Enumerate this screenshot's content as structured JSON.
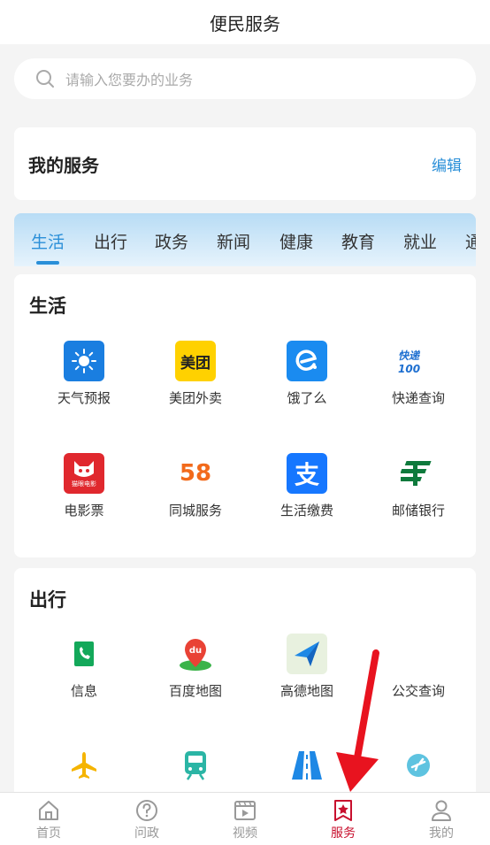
{
  "header": {
    "title": "便民服务"
  },
  "search": {
    "placeholder": "请输入您要办的业务"
  },
  "my_services": {
    "title": "我的服务",
    "edit_label": "编辑"
  },
  "category_tabs": [
    {
      "label": "生活",
      "active": true
    },
    {
      "label": "出行"
    },
    {
      "label": "政务"
    },
    {
      "label": "新闻"
    },
    {
      "label": "健康"
    },
    {
      "label": "教育"
    },
    {
      "label": "就业"
    },
    {
      "label": "通"
    }
  ],
  "sections": {
    "life": {
      "title": "生活",
      "items": [
        {
          "label": "天气预报",
          "icon": "weather-icon"
        },
        {
          "label": "美团外卖",
          "icon": "meituan-icon",
          "icon_text": "美团"
        },
        {
          "label": "饿了么",
          "icon": "eleme-icon"
        },
        {
          "label": "快递查询",
          "icon": "express-icon",
          "icon_text": "快递100"
        },
        {
          "label": "电影票",
          "icon": "maoyan-movie-icon",
          "icon_text": "猫眼电影"
        },
        {
          "label": "同城服务",
          "icon": "58-icon",
          "icon_text": "58"
        },
        {
          "label": "生活缴费",
          "icon": "alipay-icon",
          "icon_text": "支"
        },
        {
          "label": "邮储银行",
          "icon": "postal-bank-icon"
        }
      ]
    },
    "travel": {
      "title": "出行",
      "items": [
        {
          "label": "信息",
          "icon": "phone-book-icon"
        },
        {
          "label": "百度地图",
          "icon": "baidu-map-icon",
          "icon_text": "du"
        },
        {
          "label": "高德地图",
          "icon": "amap-icon"
        },
        {
          "label": "公交查询",
          "icon": "bus-query-icon"
        },
        {
          "label": "",
          "icon": "airplane-icon"
        },
        {
          "label": "",
          "icon": "train-icon"
        },
        {
          "label": "",
          "icon": "highway-icon"
        },
        {
          "label": "",
          "icon": "flight-status-icon"
        }
      ]
    }
  },
  "tabbar": [
    {
      "label": "首页",
      "icon": "home-icon"
    },
    {
      "label": "问政",
      "icon": "question-icon"
    },
    {
      "label": "视频",
      "icon": "video-icon"
    },
    {
      "label": "服务",
      "icon": "service-star-icon",
      "active": true
    },
    {
      "label": "我的",
      "icon": "profile-icon"
    }
  ],
  "colors": {
    "accent": "#2a8fd8",
    "tabbar_active": "#c8102e",
    "arrow": "#e8131f"
  }
}
